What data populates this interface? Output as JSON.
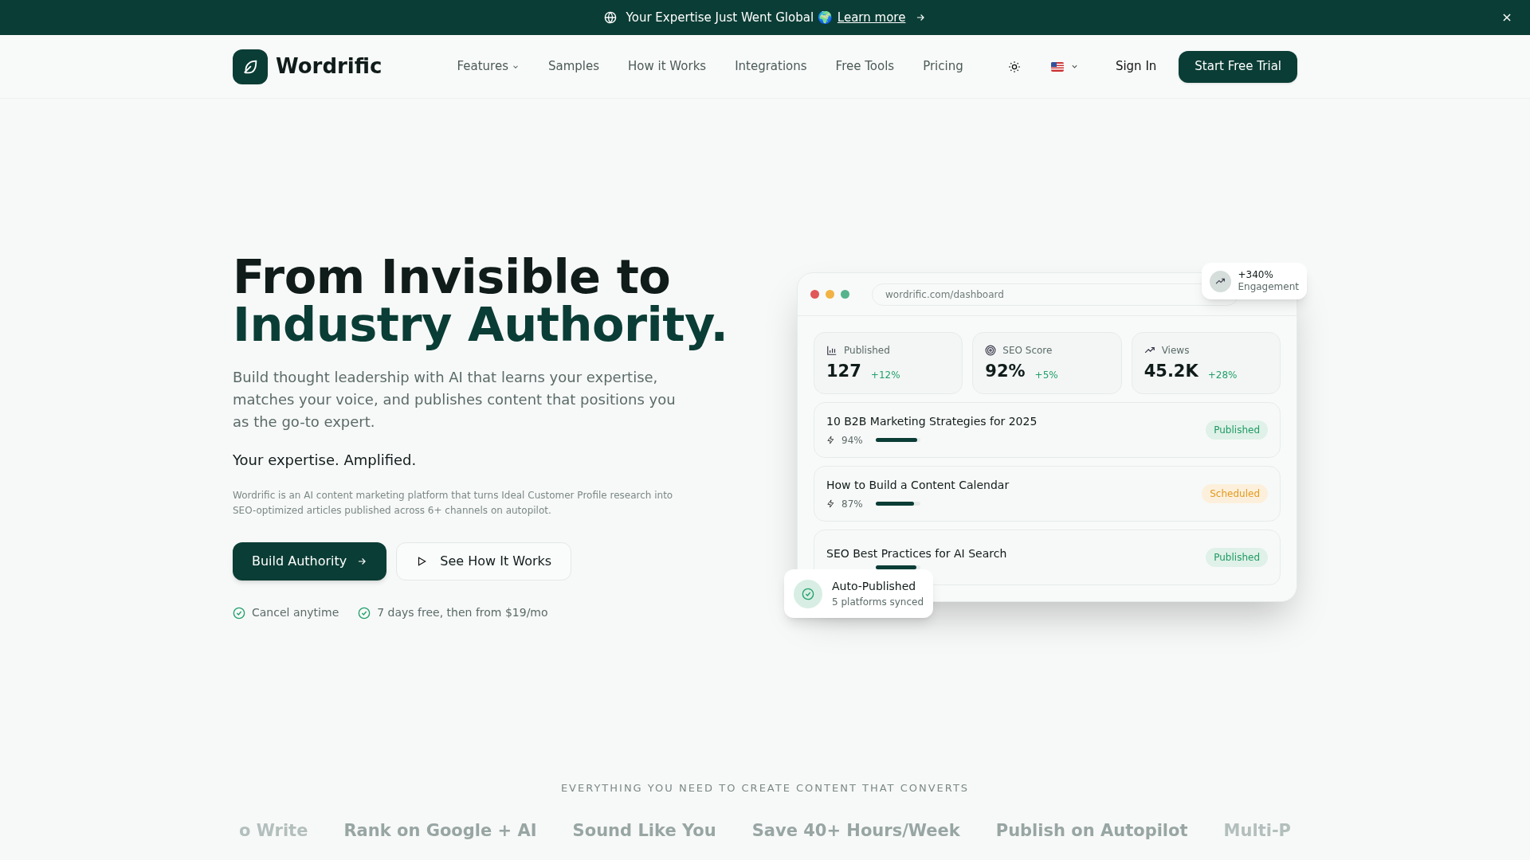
{
  "banner": {
    "text": "Your Expertise Just Went Global 🌍",
    "link": "Learn more"
  },
  "nav": {
    "brand": "Wordrific",
    "links": [
      {
        "label": "Features",
        "dropdown": true
      },
      {
        "label": "Samples",
        "dropdown": false
      },
      {
        "label": "How it Works",
        "dropdown": false
      },
      {
        "label": "Integrations",
        "dropdown": false
      },
      {
        "label": "Free Tools",
        "dropdown": false
      },
      {
        "label": "Pricing",
        "dropdown": false
      }
    ],
    "sign_in": "Sign In",
    "cta": "Start Free Trial"
  },
  "hero": {
    "title_line_1": "From Invisible to",
    "title_line_2": "Industry Authority.",
    "lead": "Build thought leadership with AI that learns your expertise, matches your voice, and publishes content that positions you as the go-to expert.",
    "tagline": "Your expertise. Amplified.",
    "description": "Wordrific is an AI content marketing platform that turns Ideal Customer Profile research into SEO-optimized articles published across 6+ channels on autopilot.",
    "primary_button": "Build Authority",
    "secondary_button": "See How It Works",
    "checks": [
      "Cancel anytime",
      "7 days free, then from $19/mo"
    ]
  },
  "dashboard": {
    "url": "wordrific.com/dashboard",
    "stats": [
      {
        "kind": "bars",
        "label": "Published",
        "value": "127",
        "change": "+12%"
      },
      {
        "kind": "target",
        "label": "SEO Score",
        "value": "92%",
        "change": "+5%"
      },
      {
        "kind": "trend",
        "label": "Views",
        "value": "45.2K",
        "change": "+28%"
      }
    ],
    "articles": [
      {
        "title": "10 B2B Marketing Strategies for 2025",
        "score": "94%",
        "level": 0.94,
        "status": "Published",
        "kind": "published"
      },
      {
        "title": "How to Build a Content Calendar",
        "score": "87%",
        "level": 0.87,
        "status": "Scheduled",
        "kind": "scheduled"
      },
      {
        "title": "SEO Best Practices for AI Search",
        "level": 0.91,
        "status": "Published",
        "kind": "published"
      }
    ],
    "engagement": {
      "value": "+340%",
      "label": "Engagement"
    },
    "auto_published": {
      "title": "Auto-Published",
      "subtitle": "5 platforms synced"
    }
  },
  "features": {
    "heading": "EVERYTHING YOU NEED TO CREATE CONTENT THAT CONVERTS",
    "items": [
      {
        "label": "o Write",
        "faded": true
      },
      {
        "label": "Rank on Google + AI",
        "faded": false
      },
      {
        "label": "Sound Like You",
        "faded": false
      },
      {
        "label": "Save 40+ Hours/Week",
        "faded": false
      },
      {
        "label": "Publish on Autopilot",
        "faded": false
      },
      {
        "label": "Multi-P",
        "faded": true
      }
    ]
  }
}
